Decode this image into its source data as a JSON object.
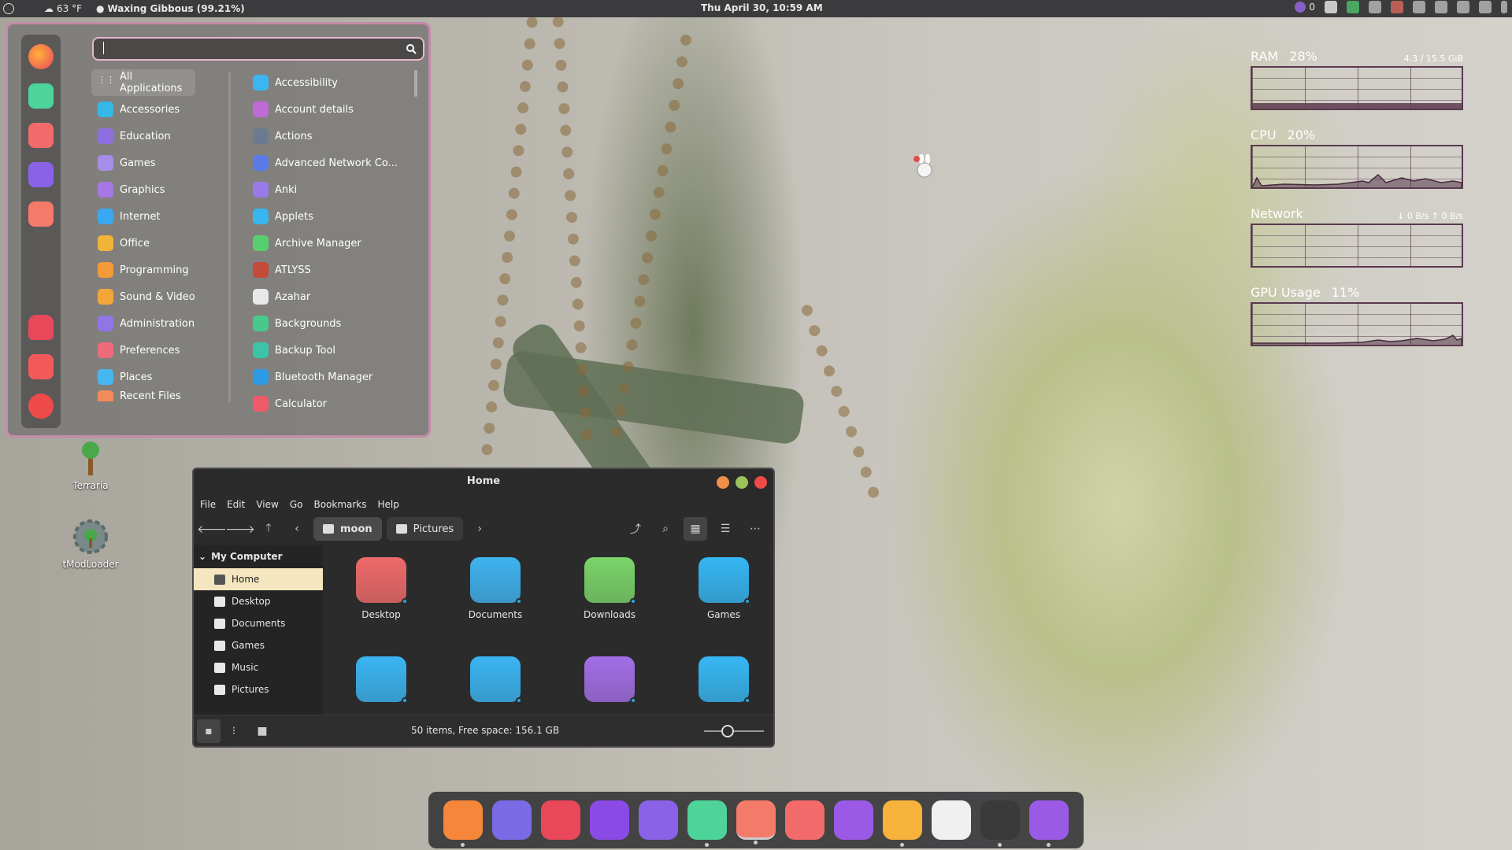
{
  "panel": {
    "weather": "63 °F",
    "moon_phase": "Waxing Gibbous (99.21%)",
    "datetime": "Thu April 30, 10:59 AM",
    "notif_count": "0"
  },
  "app_menu": {
    "search_value": "",
    "categories": [
      {
        "label": "All Applications",
        "color": "#9aa0a6"
      },
      {
        "label": "Accessories",
        "color": "#35b7e8"
      },
      {
        "label": "Education",
        "color": "#8f6fe0"
      },
      {
        "label": "Games",
        "color": "#a58de8"
      },
      {
        "label": "Graphics",
        "color": "#a678e6"
      },
      {
        "label": "Internet",
        "color": "#3aa8f0"
      },
      {
        "label": "Office",
        "color": "#f0b43a"
      },
      {
        "label": "Programming",
        "color": "#f49a3a"
      },
      {
        "label": "Sound & Video",
        "color": "#f3a63a"
      },
      {
        "label": "Administration",
        "color": "#8f75e6"
      },
      {
        "label": "Preferences",
        "color": "#ef6a7b"
      },
      {
        "label": "Places",
        "color": "#46b7f0"
      },
      {
        "label": "Recent Files",
        "color": "#f28a5a"
      }
    ],
    "apps": [
      {
        "label": "Accessibility",
        "color": "#3ab6f0"
      },
      {
        "label": "Account details",
        "color": "#c06ad6"
      },
      {
        "label": "Actions",
        "color": "#6b7a90"
      },
      {
        "label": "Advanced Network Co...",
        "color": "#5a7ae6"
      },
      {
        "label": "Anki",
        "color": "#9a7ae8"
      },
      {
        "label": "Applets",
        "color": "#38b6ef"
      },
      {
        "label": "Archive Manager",
        "color": "#57cf6e"
      },
      {
        "label": "ATLYSS",
        "color": "#c44a3a"
      },
      {
        "label": "Azahar",
        "color": "#e8e8e8"
      },
      {
        "label": "Backgrounds",
        "color": "#48c98c"
      },
      {
        "label": "Backup Tool",
        "color": "#3cc4a8"
      },
      {
        "label": "Bluetooth Manager",
        "color": "#2d9ae6"
      },
      {
        "label": "Calculator",
        "color": "#ef5a6a"
      }
    ]
  },
  "desktop_icons": [
    {
      "label": "Terraria"
    },
    {
      "label": "tModLoader"
    }
  ],
  "sysmon": {
    "ram": {
      "title": "RAM",
      "value": "28%",
      "detail": "4.3 / 15.5 GiB",
      "level": 0.28
    },
    "cpu": {
      "title": "CPU",
      "value": "20%",
      "level": 0.2
    },
    "network": {
      "title": "Network",
      "detail": "↓ 0 B/s  ↑ 0 B/s"
    },
    "gpu": {
      "title": "GPU Usage",
      "value": "11%",
      "level": 0.11
    }
  },
  "file_manager": {
    "title": "Home",
    "menu": [
      "File",
      "Edit",
      "View",
      "Go",
      "Bookmarks",
      "Help"
    ],
    "crumbs": [
      "moon",
      "Pictures"
    ],
    "sidebar_heading": "My Computer",
    "sidebar_items": [
      "Home",
      "Desktop",
      "Documents",
      "Games",
      "Music",
      "Pictures"
    ],
    "files": [
      {
        "label": "Desktop",
        "color": "#ef6a6a"
      },
      {
        "label": "Documents",
        "color": "#3fb3ef"
      },
      {
        "label": "Downloads",
        "color": "#7bd46a"
      },
      {
        "label": "Games",
        "color": "#35b6f3"
      },
      {
        "label": "",
        "color": "#3ab5f2"
      },
      {
        "label": "",
        "color": "#3ab5f2"
      },
      {
        "label": "",
        "color": "#a36ee6"
      },
      {
        "label": "",
        "color": "#36b7f3"
      }
    ],
    "status": "50 items, Free space: 156.1 GB",
    "zoom_level": 0.4
  },
  "dock": [
    {
      "name": "firefox",
      "color": "#f5863a",
      "running": true
    },
    {
      "name": "discord",
      "color": "#7a6ae6",
      "running": false
    },
    {
      "name": "flathub",
      "color": "#e8485a",
      "running": false
    },
    {
      "name": "app-purple",
      "color": "#8a4ae6",
      "running": false
    },
    {
      "name": "terminal",
      "color": "#8a62e8",
      "running": false
    },
    {
      "name": "store",
      "color": "#4ed39a",
      "running": true
    },
    {
      "name": "files",
      "color": "#f47a6a",
      "running": true
    },
    {
      "name": "system-settings",
      "color": "#f36a6a",
      "running": false
    },
    {
      "name": "waveform",
      "color": "#9a5ae6",
      "running": false
    },
    {
      "name": "image-viewer",
      "color": "#f6b23a",
      "running": true
    },
    {
      "name": "help",
      "color": "#f0f0f0",
      "running": false
    },
    {
      "name": "goose",
      "color": "#3a3a3a",
      "running": true
    },
    {
      "name": "draw",
      "color": "#9a5ae6",
      "running": true
    }
  ]
}
